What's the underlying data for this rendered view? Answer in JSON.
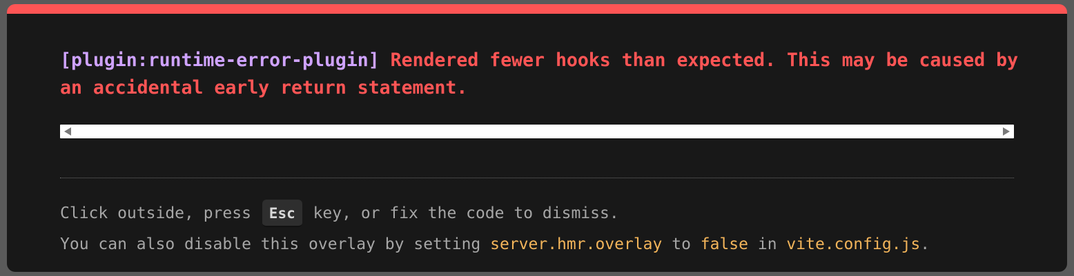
{
  "error": {
    "plugin_label": "[plugin:runtime-error-plugin]",
    "message": "Rendered fewer hooks than expected. This may be caused by an accidental early return statement."
  },
  "tip": {
    "line1_before": "Click outside, press ",
    "key": "Esc",
    "line1_after": " key, or fix the code to dismiss.",
    "line2_part1": "You can also disable this overlay by setting ",
    "setting_name": "server.hmr.overlay",
    "line2_part2": " to ",
    "setting_value": "false",
    "line2_part3": " in ",
    "config_file": "vite.config.js",
    "line2_part4": "."
  },
  "colors": {
    "accent_error": "#ff5555",
    "plugin": "#cfa3ff",
    "code": "#f2b45a",
    "background": "#181818"
  }
}
